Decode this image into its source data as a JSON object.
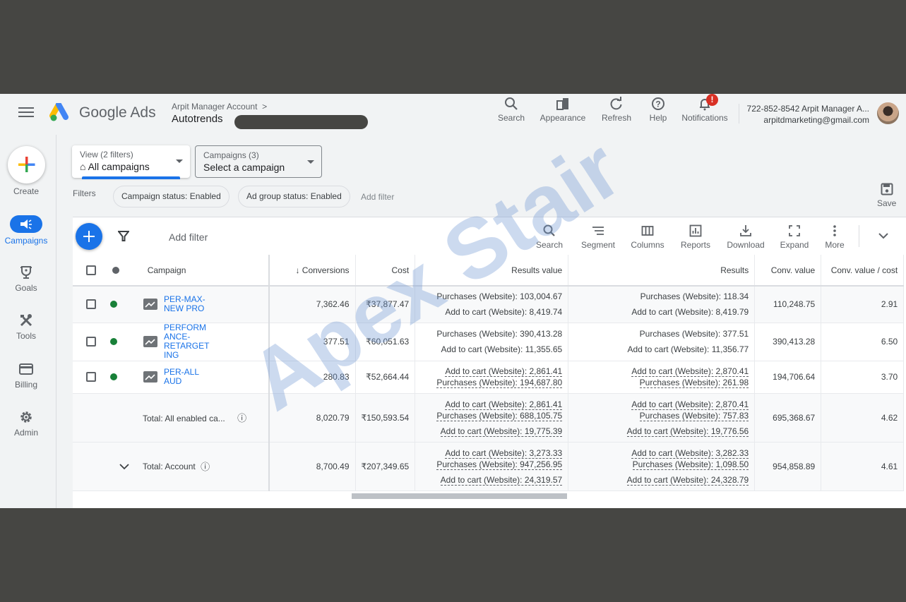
{
  "header": {
    "brand": "Google Ads",
    "breadcrumb": "Arpit Manager Account",
    "account_name": "Autotrends",
    "actions": [
      {
        "label": "Search",
        "icon": "search-icon"
      },
      {
        "label": "Appearance",
        "icon": "appearance-icon"
      },
      {
        "label": "Refresh",
        "icon": "refresh-icon"
      },
      {
        "label": "Help",
        "icon": "help-icon"
      },
      {
        "label": "Notifications",
        "icon": "bell-icon"
      }
    ],
    "notification_badge": "!",
    "user_line1": "722-852-8542 Arpit Manager A...",
    "user_line2": "arpitdmarketing@gmail.com"
  },
  "nav": {
    "create": "Create",
    "items": [
      {
        "label": "Campaigns",
        "icon": "megaphone-icon",
        "active": true
      },
      {
        "label": "Goals",
        "icon": "trophy-icon"
      },
      {
        "label": "Tools",
        "icon": "tools-icon"
      },
      {
        "label": "Billing",
        "icon": "credit-card-icon"
      },
      {
        "label": "Admin",
        "icon": "gear-icon"
      }
    ]
  },
  "view": {
    "view_title": "View (2 filters)",
    "view_value": "All campaigns",
    "campaigns_title": "Campaigns (3)",
    "campaigns_value": "Select a campaign",
    "filters_label": "Filters",
    "chips": [
      "Campaign status: Enabled",
      "Ad group status: Enabled"
    ],
    "add_filter": "Add filter",
    "save": "Save"
  },
  "toolbar": {
    "add_filter": "Add filter",
    "tools": [
      "Search",
      "Segment",
      "Columns",
      "Reports",
      "Download",
      "Expand",
      "More"
    ]
  },
  "table": {
    "columns": [
      "Campaign",
      "Conversions",
      "Cost",
      "Results value",
      "Results",
      "Conv. value",
      "Conv. value / cost"
    ],
    "rows": [
      {
        "name": "PER-MAX-NEW PRO",
        "name_lines": [
          "PER-MAX-",
          "NEW PRO"
        ],
        "conversions": "7,362.46",
        "cost": "₹37,877.47",
        "results_value": [
          "Purchases (Website): 103,004.67",
          "Add to cart (Website): 8,419.74"
        ],
        "results": [
          "Purchases (Website): 118.34",
          "Add to cart (Website): 8,419.79"
        ],
        "conv_value": "110,248.75",
        "conv_value_cost": "2.91"
      },
      {
        "name": "PERFORMANCE-RETARGETING",
        "name_lines": [
          "PERFORM",
          "ANCE-",
          "RETARGET",
          "ING"
        ],
        "conversions": "377.51",
        "cost": "₹60,051.63",
        "results_value": [
          "Purchases (Website): 390,413.28",
          "Add to cart (Website): 11,355.65"
        ],
        "results": [
          "Purchases (Website): 377.51",
          "Add to cart (Website): 11,356.77"
        ],
        "conv_value": "390,413.28",
        "conv_value_cost": "6.50"
      },
      {
        "name": "PER-ALL AUD",
        "name_lines": [
          "PER-ALL",
          "AUD"
        ],
        "conversions": "280.83",
        "cost": "₹52,664.44",
        "results_value": [
          "Add to cart (Website): 2,861.41",
          "Purchases (Website): 194,687.80"
        ],
        "results": [
          "Add to cart (Website): 2,870.41",
          "Purchases (Website): 261.98"
        ],
        "conv_value": "194,706.64",
        "conv_value_cost": "3.70"
      }
    ],
    "totals": [
      {
        "label": "Total: All enabled ca...",
        "conversions": "8,020.79",
        "cost": "₹150,593.54",
        "results_value": [
          "Add to cart (Website): 2,861.41",
          "Purchases (Website): 688,105.75",
          "Add to cart (Website): 19,775.39"
        ],
        "results": [
          "Add to cart (Website): 2,870.41",
          "Purchases (Website): 757.83",
          "Add to cart (Website): 19,776.56"
        ],
        "conv_value": "695,368.67",
        "conv_value_cost": "4.62"
      },
      {
        "label": "Total: Account",
        "conversions": "8,700.49",
        "cost": "₹207,349.65",
        "results_value": [
          "Add to cart (Website): 3,273.33",
          "Purchases (Website): 947,256.95",
          "Add to cart (Website): 24,319.57"
        ],
        "results": [
          "Add to cart (Website): 3,282.33",
          "Purchases (Website): 1,098.50",
          "Add to cart (Website): 24,328.79"
        ],
        "conv_value": "954,858.89",
        "conv_value_cost": "4.61"
      }
    ]
  },
  "watermark": "Apex Stair",
  "colors": {
    "accent": "#1a73e8",
    "enabled": "#188038",
    "alert": "#d93025"
  }
}
